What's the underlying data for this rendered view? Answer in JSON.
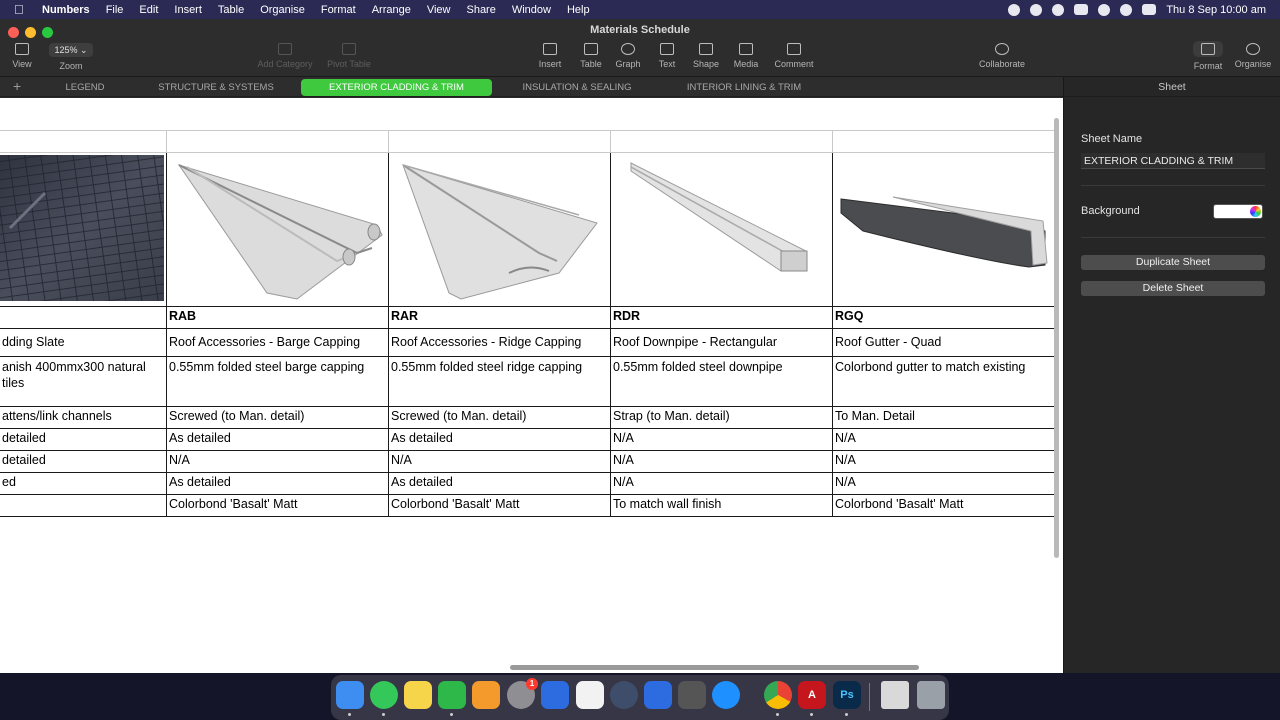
{
  "menubar": {
    "app_name": "Numbers",
    "items": [
      "File",
      "Edit",
      "Insert",
      "Table",
      "Organise",
      "Format",
      "Arrange",
      "View",
      "Share",
      "Window",
      "Help"
    ],
    "clock": "Thu 8 Sep  10:00 am"
  },
  "window": {
    "title": "Materials Schedule",
    "toolbar": {
      "view": "View",
      "zoom_value": "125% ⌄",
      "zoom": "Zoom",
      "add_category": "Add Category",
      "pivot_table": "Pivot Table",
      "insert": "Insert",
      "table": "Table",
      "graph": "Graph",
      "text": "Text",
      "shape": "Shape",
      "media": "Media",
      "comment": "Comment",
      "collaborate": "Collaborate",
      "format": "Format",
      "organise": "Organise"
    }
  },
  "sheet_tabs": {
    "add": "+",
    "tabs": [
      "LEGEND",
      "STRUCTURE & SYSTEMS",
      "EXTERIOR CLADDING & TRIM",
      "INSULATION & SEALING",
      "INTERIOR LINING & TRIM"
    ],
    "active": "EXTERIOR CLADDING & TRIM"
  },
  "table": {
    "columns": [
      {
        "image": "slate-roof-photo",
        "code": "",
        "name": "dding Slate",
        "description": "anish 400mmx300 natural tiles",
        "fixing": "attens/link channels",
        "r1": "detailed",
        "r2": "detailed",
        "r3": "ed",
        "finish": ""
      },
      {
        "image": "barge-capping-photo",
        "code": "RAB",
        "name": "Roof Accessories - Barge Capping",
        "description": "0.55mm folded steel barge capping",
        "fixing": "Screwed (to Man. detail)",
        "r1": "As detailed",
        "r2": "N/A",
        "r3": "As detailed",
        "finish": "Colorbond 'Basalt' Matt"
      },
      {
        "image": "ridge-capping-photo",
        "code": "RAR",
        "name": "Roof Accessories - Ridge Capping",
        "description": "0.55mm folded steel ridge capping",
        "fixing": "Screwed (to Man. detail)",
        "r1": "As detailed",
        "r2": "N/A",
        "r3": "As detailed",
        "finish": "Colorbond 'Basalt' Matt"
      },
      {
        "image": "rectangular-downpipe-photo",
        "code": "RDR",
        "name": "Roof Downpipe - Rectangular",
        "description": "0.55mm folded steel downpipe",
        "fixing": "Strap (to Man. detail)",
        "r1": "N/A",
        "r2": "N/A",
        "r3": "N/A",
        "finish": "To match wall finish"
      },
      {
        "image": "quad-gutter-photo",
        "code": "RGQ",
        "name": "Roof Gutter - Quad",
        "description": "Colorbond gutter to match existing",
        "fixing": "To Man. Detail",
        "r1": "N/A",
        "r2": "N/A",
        "r3": "N/A",
        "finish": "Colorbond 'Basalt' Matt"
      }
    ]
  },
  "sidebar": {
    "header": "Sheet",
    "sheet_name_label": "Sheet Name",
    "sheet_name_value": "EXTERIOR CLADDING & TRIM",
    "background_label": "Background",
    "background_color": "#ffffff",
    "duplicate_button": "Duplicate Sheet",
    "delete_button": "Delete Sheet"
  },
  "dock": {
    "apps": [
      "Finder",
      "Messages",
      "Notes",
      "Numbers",
      "Pages",
      "System Preferences",
      "Safari Dev",
      "Scripts",
      "QuickTime",
      "Arc",
      "Calculator",
      "Safari",
      "Chrome",
      "Acrobat",
      "Photoshop",
      "Screenshot",
      "Trash"
    ],
    "system_prefs_badge": "1",
    "acrobat_label": "A",
    "photoshop_label": "Ps"
  }
}
